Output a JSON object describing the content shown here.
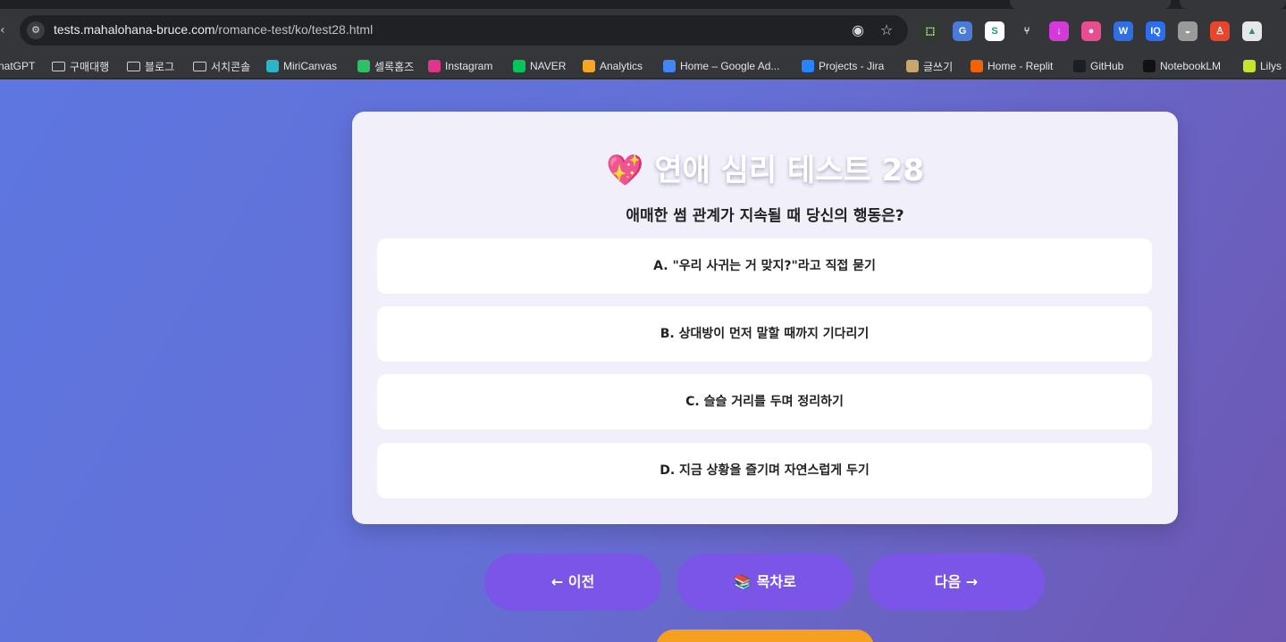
{
  "browser": {
    "nav_fragment": "‹",
    "url_host": "tests.mahalohana-bruce.com",
    "url_path": "/romance-test/ko/test28.html",
    "omnibox_icons": [
      "eye-icon",
      "star-icon"
    ],
    "extensions": [
      {
        "name": "extension-1",
        "color": "#2e3b2a",
        "glyph": "⬚"
      },
      {
        "name": "google-translate-extension",
        "color": "#4a7bd9",
        "glyph": "G"
      },
      {
        "name": "s-extension",
        "color": "#ffffff",
        "glyph": "S"
      },
      {
        "name": "fork-extension",
        "color": "#35363a",
        "glyph": "⑂"
      },
      {
        "name": "download-extension",
        "color": "#d43ad8",
        "glyph": "↓"
      },
      {
        "name": "color-extension",
        "color": "#e94d8f",
        "glyph": "●"
      },
      {
        "name": "w-extension",
        "color": "#2f6fe4",
        "glyph": "W"
      },
      {
        "name": "iq-extension",
        "color": "#2d6ef0",
        "glyph": "IQ"
      },
      {
        "name": "bowl-extension",
        "color": "#9a9a9a",
        "glyph": "◒"
      },
      {
        "name": "figure-extension",
        "color": "#e8452d",
        "glyph": "♙"
      },
      {
        "name": "drive-extension",
        "color": "#e7e7e7",
        "glyph": "▲"
      }
    ]
  },
  "bookmarks": [
    {
      "label": "natGPT",
      "icon": "chatgpt-icon",
      "color": "transparent"
    },
    {
      "label": "구매대행",
      "icon": "folder-icon",
      "color": ""
    },
    {
      "label": "블로그",
      "icon": "folder-icon",
      "color": ""
    },
    {
      "label": "서치콘솔",
      "icon": "folder-icon",
      "color": ""
    },
    {
      "label": "MiriCanvas",
      "icon": "miricanvas-icon",
      "color": "#2bb5c9"
    },
    {
      "label": "셀록홈즈",
      "icon": "sellrock-icon",
      "color": "#2fbf67"
    },
    {
      "label": "Instagram",
      "icon": "instagram-icon",
      "color": "#e0358a"
    },
    {
      "label": "NAVER",
      "icon": "naver-icon",
      "color": "#03c75a"
    },
    {
      "label": "Analytics",
      "icon": "analytics-icon",
      "color": "#f5a623"
    },
    {
      "label": "Home – Google Ad...",
      "icon": "google-ads-icon",
      "color": "#4285f4"
    },
    {
      "label": "Projects - Jira",
      "icon": "jira-icon",
      "color": "#2684ff"
    },
    {
      "label": "글쓰기",
      "icon": "writing-icon",
      "color": "#c9a66b"
    },
    {
      "label": "Home - Replit",
      "icon": "replit-icon",
      "color": "#f26207"
    },
    {
      "label": "GitHub",
      "icon": "github-icon",
      "color": "#1b1f23"
    },
    {
      "label": "NotebookLM",
      "icon": "notebooklm-icon",
      "color": "#111111"
    },
    {
      "label": "Lilys",
      "icon": "lilys-icon",
      "color": "#c7e42a"
    }
  ],
  "quiz": {
    "title_emoji": "💖",
    "title": "연애 심리 테스트 28",
    "question": "애매한 썸 관계가 지속될 때 당신의 행동은?",
    "options": [
      "A. \"우리 사귀는 거 맞지?\"라고 직접 묻기",
      "B. 상대방이 먼저 말할 때까지 기다리기",
      "C. 슬슬 거리를 두며 정리하기",
      "D. 지금 상황을 즐기며 자연스럽게 두기"
    ]
  },
  "nav": {
    "prev": "← 이전",
    "toc": "📚 목차로",
    "next": "다음 →"
  }
}
